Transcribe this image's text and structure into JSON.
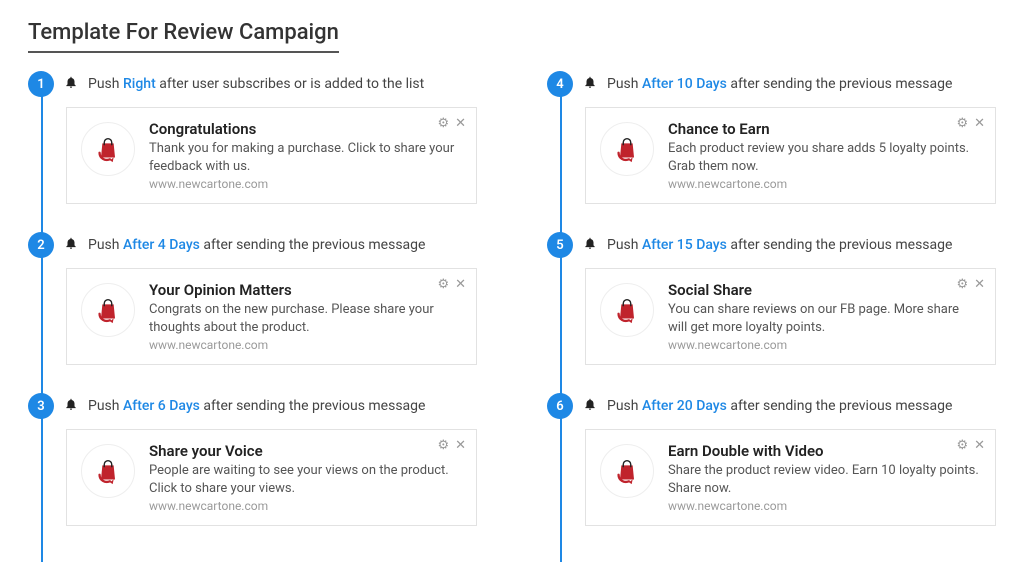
{
  "page_title": "Template For Review Campaign",
  "accent_color": "#1e88e5",
  "bag_color": "#c0232c",
  "push_label": "Push",
  "steps": [
    {
      "num": "1",
      "timing": "Right",
      "suffix": "after user subscribes or is added to the list",
      "title": "Congratulations",
      "desc": "Thank you for making a purchase. Click to share your feedback with us.",
      "domain": "www.newcartone.com"
    },
    {
      "num": "2",
      "timing": "After 4 Days",
      "suffix": "after sending the previous message",
      "title": "Your Opinion Matters",
      "desc": "Congrats on the new purchase. Please share your thoughts about the product.",
      "domain": "www.newcartone.com"
    },
    {
      "num": "3",
      "timing": "After 6 Days",
      "suffix": "after sending the previous message",
      "title": "Share your Voice",
      "desc": "People are waiting to see your views on the product. Click to share your views.",
      "domain": "www.newcartone.com"
    },
    {
      "num": "4",
      "timing": "After 10 Days",
      "suffix": "after sending the previous message",
      "title": "Chance to Earn",
      "desc": "Each product review you share adds 5 loyalty points. Grab them now.",
      "domain": "www.newcartone.com"
    },
    {
      "num": "5",
      "timing": "After 15 Days",
      "suffix": "after sending the previous message",
      "title": "Social Share",
      "desc": "You can share reviews on our FB page. More share will get more loyalty points.",
      "domain": "www.newcartone.com"
    },
    {
      "num": "6",
      "timing": "After 20 Days",
      "suffix": "after sending the previous message",
      "title": "Earn Double with Video",
      "desc": "Share the product review video. Earn 10 loyalty points. Share now.",
      "domain": "www.newcartone.com"
    }
  ]
}
